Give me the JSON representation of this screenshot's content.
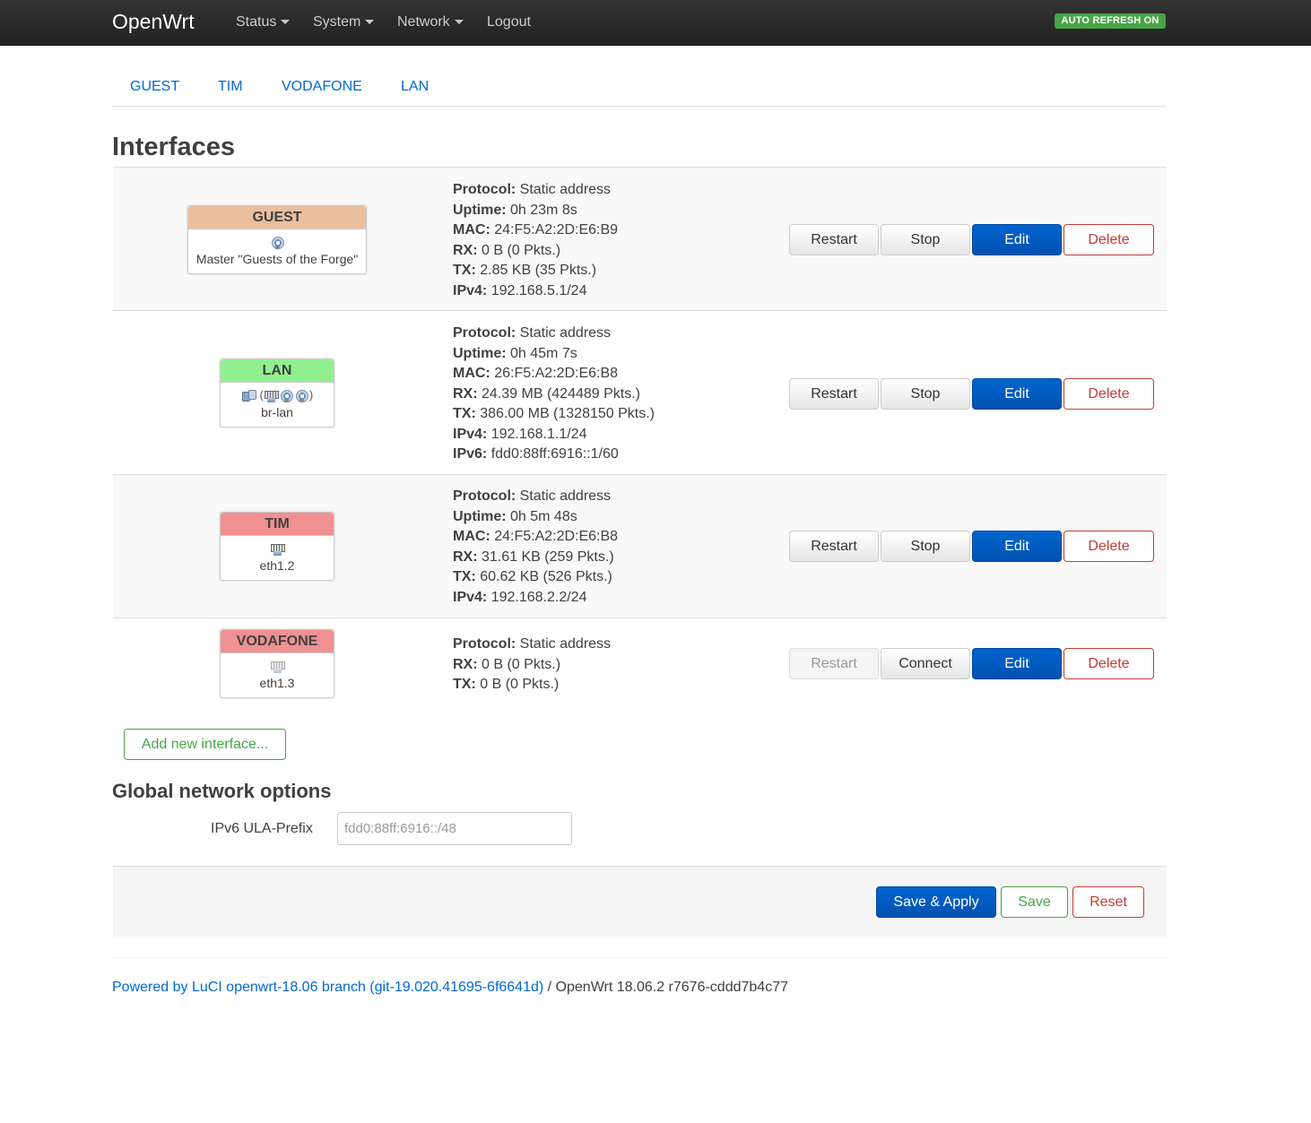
{
  "navbar": {
    "brand": "OpenWrt",
    "menu": [
      {
        "label": "Status",
        "dropdown": true
      },
      {
        "label": "System",
        "dropdown": true
      },
      {
        "label": "Network",
        "dropdown": true
      },
      {
        "label": "Logout",
        "dropdown": false
      }
    ],
    "auto_refresh": "AUTO REFRESH ON"
  },
  "tabs": [
    "GUEST",
    "TIM",
    "VODAFONE",
    "LAN"
  ],
  "page_title": "Interfaces",
  "interfaces": [
    {
      "name": "GUEST",
      "color": "#eabf9e",
      "device": "Master \"Guests of the Forge\"",
      "icons": [
        "wifi-icon"
      ],
      "info": [
        {
          "k": "Protocol:",
          "v": " Static address"
        },
        {
          "k": "Uptime:",
          "v": " 0h 23m 8s"
        },
        {
          "k": "MAC:",
          "v": " 24:F5:A2:2D:E6:B9"
        },
        {
          "k": "RX:",
          "v": " 0 B (0 Pkts.)"
        },
        {
          "k": "TX:",
          "v": " 2.85 KB (35 Pkts.)"
        },
        {
          "k": "IPv4:",
          "v": " 192.168.5.1/24"
        }
      ],
      "buttons": {
        "restart": "Restart",
        "stop": "Stop",
        "edit": "Edit",
        "delete": "Delete"
      }
    },
    {
      "name": "LAN",
      "color": "#90f090",
      "device": "br-lan",
      "icons": [
        "bridge-icon",
        "ethernet-icon",
        "wifi-icon",
        "wifi-icon"
      ],
      "info": [
        {
          "k": "Protocol:",
          "v": " Static address"
        },
        {
          "k": "Uptime:",
          "v": " 0h 45m 7s"
        },
        {
          "k": "MAC:",
          "v": " 26:F5:A2:2D:E6:B8"
        },
        {
          "k": "RX:",
          "v": " 24.39 MB (424489 Pkts.)"
        },
        {
          "k": "TX:",
          "v": " 386.00 MB (1328150 Pkts.)"
        },
        {
          "k": "IPv4:",
          "v": " 192.168.1.1/24"
        },
        {
          "k": "IPv6:",
          "v": " fdd0:88ff:6916::1/60"
        }
      ],
      "buttons": {
        "restart": "Restart",
        "stop": "Stop",
        "edit": "Edit",
        "delete": "Delete"
      }
    },
    {
      "name": "TIM",
      "color": "#f09090",
      "device": "eth1.2",
      "icons": [
        "ethernet-icon"
      ],
      "info": [
        {
          "k": "Protocol:",
          "v": " Static address"
        },
        {
          "k": "Uptime:",
          "v": " 0h 5m 48s"
        },
        {
          "k": "MAC:",
          "v": " 24:F5:A2:2D:E6:B8"
        },
        {
          "k": "RX:",
          "v": " 31.61 KB (259 Pkts.)"
        },
        {
          "k": "TX:",
          "v": " 60.62 KB (526 Pkts.)"
        },
        {
          "k": "IPv4:",
          "v": " 192.168.2.2/24"
        }
      ],
      "buttons": {
        "restart": "Restart",
        "stop": "Stop",
        "edit": "Edit",
        "delete": "Delete"
      }
    },
    {
      "name": "VODAFONE",
      "color": "#f09090",
      "device": "eth1.3",
      "icons": [
        "ethernet-icon"
      ],
      "info": [
        {
          "k": "Protocol:",
          "v": " Static address"
        },
        {
          "k": "RX:",
          "v": " 0 B (0 Pkts.)"
        },
        {
          "k": "TX:",
          "v": " 0 B (0 Pkts.)"
        }
      ],
      "buttons": {
        "restart": "Restart",
        "stop": "Connect",
        "edit": "Edit",
        "delete": "Delete"
      },
      "restart_disabled": true
    }
  ],
  "add_interface": "Add new interface...",
  "global": {
    "title": "Global network options",
    "ula_label": "IPv6 ULA-Prefix",
    "ula_value": "fdd0:88ff:6916::/48"
  },
  "actions": {
    "save_apply": "Save & Apply",
    "save": "Save",
    "reset": "Reset"
  },
  "footer": {
    "link_text": "Powered by LuCI openwrt-18.06 branch (git-19.020.41695-6f6641d)",
    "separator": " / ",
    "version": "OpenWrt 18.06.2 r7676-cddd7b4c77"
  }
}
